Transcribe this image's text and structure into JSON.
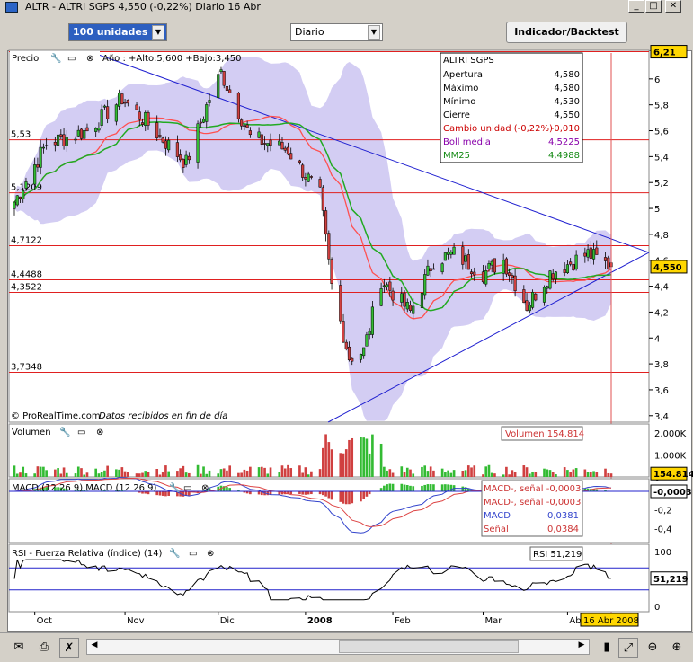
{
  "window": {
    "title": "ALTR - ALTRI SGPS     4,550 (-0,22%)     Diario  16 Abr"
  },
  "toolbar": {
    "units": "100 unidades",
    "period": "Diario",
    "indicator_button": "Indicador/Backtest"
  },
  "price_panel": {
    "label": "Precio",
    "year_info": "Año : +Alto:5,600 +Bajo:3,450",
    "watermark": "© ProRealTime.com",
    "watermark_note": "Datos recibidos en fin de día",
    "ticks": [
      "6",
      "5,8",
      "5,6",
      "5,4",
      "5,2",
      "5",
      "4,8",
      "4,6",
      "4,4",
      "4,2",
      "4",
      "3,8",
      "3,6",
      "3,4"
    ],
    "hline_labels": [
      "5,53",
      "5,1209",
      "4,7122",
      "4,4488",
      "4,3522",
      "3,7348"
    ],
    "top_tag": "6,21",
    "last_tag": "4,550",
    "info": {
      "name": "ALTRI SGPS",
      "rows": [
        {
          "label": "Apertura",
          "value": "4,580"
        },
        {
          "label": "Máximo",
          "value": "4,580"
        },
        {
          "label": "Mínimo",
          "value": "4,530"
        },
        {
          "label": "Cierre",
          "value": "4,550"
        },
        {
          "label": "Cambio unidad (-0,22%)",
          "value": "-0,010"
        },
        {
          "label": "Boll media",
          "value": "4,5225"
        },
        {
          "label": "MM25",
          "value": "4,4988"
        }
      ]
    }
  },
  "volume_panel": {
    "label": "Volumen",
    "box": "Volumen 154.814",
    "ticks": [
      "2.000K",
      "1.000K",
      "0"
    ],
    "last_tag": "154.814"
  },
  "macd_panel": {
    "label": "MACD (12 26 9) MACD (12 26 9)",
    "box": [
      "MACD-, señal -0,0003",
      "MACD-, señal -0,0003",
      "MACD",
      "0,0381",
      "Señal",
      "0,0384"
    ],
    "ticks": [
      "-0,2",
      "-0,4"
    ],
    "last_tag": "-0,0003"
  },
  "rsi_panel": {
    "label": "RSI - Fuerza Relativa (índice) (14)",
    "box": "RSI 51,219",
    "ticks": [
      "100",
      "0"
    ],
    "last_tag": "51,219"
  },
  "xaxis": {
    "labels": [
      "Oct",
      "Nov",
      "Dic",
      "2008",
      "Feb",
      "Mar",
      "Abr"
    ],
    "date_tag": "16 Abr 2008"
  },
  "chart_data": {
    "type": "candlestick",
    "title": "ALTR - ALTRI SGPS",
    "ylim": [
      3.35,
      6.2
    ],
    "period": "Diario",
    "ohlc_last": {
      "open": 4.58,
      "high": 4.58,
      "low": 4.53,
      "close": 4.55
    },
    "close_waypoints": [
      {
        "date": "2007-09-24",
        "close": 5.05
      },
      {
        "date": "2007-10-05",
        "close": 5.5
      },
      {
        "date": "2007-10-19",
        "close": 5.6
      },
      {
        "date": "2007-10-31",
        "close": 5.85
      },
      {
        "date": "2007-11-09",
        "close": 5.65
      },
      {
        "date": "2007-11-22",
        "close": 5.35
      },
      {
        "date": "2007-11-30",
        "close": 5.85
      },
      {
        "date": "2007-12-04",
        "close": 6.05
      },
      {
        "date": "2007-12-14",
        "close": 5.55
      },
      {
        "date": "2007-12-27",
        "close": 5.45
      },
      {
        "date": "2008-01-07",
        "close": 5.1
      },
      {
        "date": "2008-01-11",
        "close": 4.4
      },
      {
        "date": "2008-01-17",
        "close": 3.85
      },
      {
        "date": "2008-01-22",
        "close": 3.9
      },
      {
        "date": "2008-01-28",
        "close": 4.45
      },
      {
        "date": "2008-02-07",
        "close": 4.2
      },
      {
        "date": "2008-02-15",
        "close": 4.6
      },
      {
        "date": "2008-02-22",
        "close": 4.65
      },
      {
        "date": "2008-03-03",
        "close": 4.5
      },
      {
        "date": "2008-03-10",
        "close": 4.6
      },
      {
        "date": "2008-03-18",
        "close": 4.25
      },
      {
        "date": "2008-03-26",
        "close": 4.5
      },
      {
        "date": "2008-04-08",
        "close": 4.65
      },
      {
        "date": "2008-04-16",
        "close": 4.55
      }
    ],
    "horizontal_levels": [
      6.21,
      5.53,
      5.1209,
      4.7122,
      4.4488,
      4.3522,
      3.7348
    ],
    "rsi_last": 51.219,
    "macd_last": 0.0381,
    "signal_last": 0.0384,
    "volume_last": 154814
  },
  "colors": {
    "up": "#33bb33",
    "down": "#d04040",
    "bands": "#c8c0f0",
    "mm25": "#22aa22",
    "boll": "#ff5050",
    "trend": "#2020d0",
    "hline": "#e02020"
  }
}
